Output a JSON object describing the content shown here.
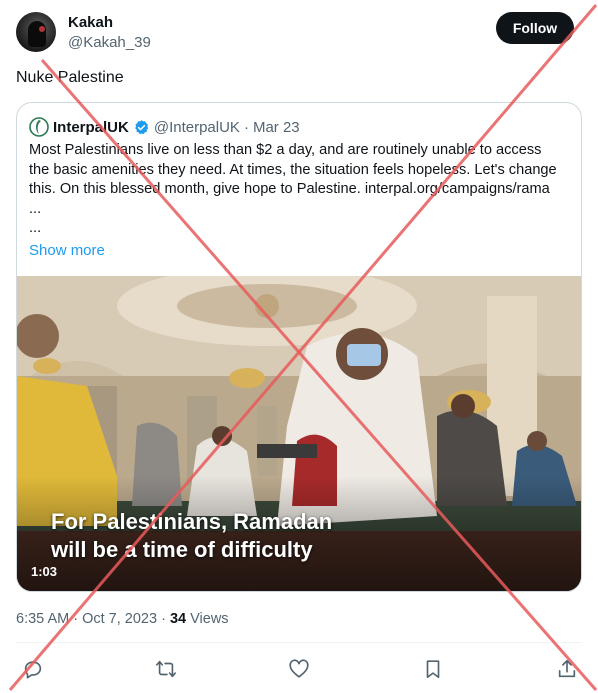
{
  "author": {
    "name": "Kakah",
    "handle": "@Kakah_39",
    "follow_label": "Follow"
  },
  "tweet": {
    "text": "Nuke Palestine",
    "time": "6:35 AM",
    "date_sep": " · ",
    "date": "Oct 7, 2023",
    "views_sep": " · ",
    "views_count": "34",
    "views_label": " Views"
  },
  "quote": {
    "name": "InterpalUK",
    "handle": "@InterpalUK",
    "separator": "·",
    "date": "Mar 23",
    "lines": [
      "Most Palestinians live on less than $2 a day, and are routinely unable to access",
      "the basic amenities they need. At times, the situation feels hopeless. Let's change",
      "this. On this blessed month, give hope to Palestine. interpal.org/campaigns/rama",
      "...",
      "..."
    ],
    "show_more": "Show more",
    "media": {
      "caption_line1": "For Palestinians, Ramadan",
      "caption_line2": "will be a time of difficulty",
      "duration": "1:03"
    }
  },
  "actions": [
    "reply-icon",
    "retweet-icon",
    "like-icon",
    "bookmark-icon",
    "share-icon"
  ],
  "colors": {
    "follow_bg": "#0f1419",
    "link": "#1d9bf0",
    "verified": "#1d9bf0",
    "interpal_brand": "#2b7a55",
    "overlay_cross": "#e85a5a"
  }
}
